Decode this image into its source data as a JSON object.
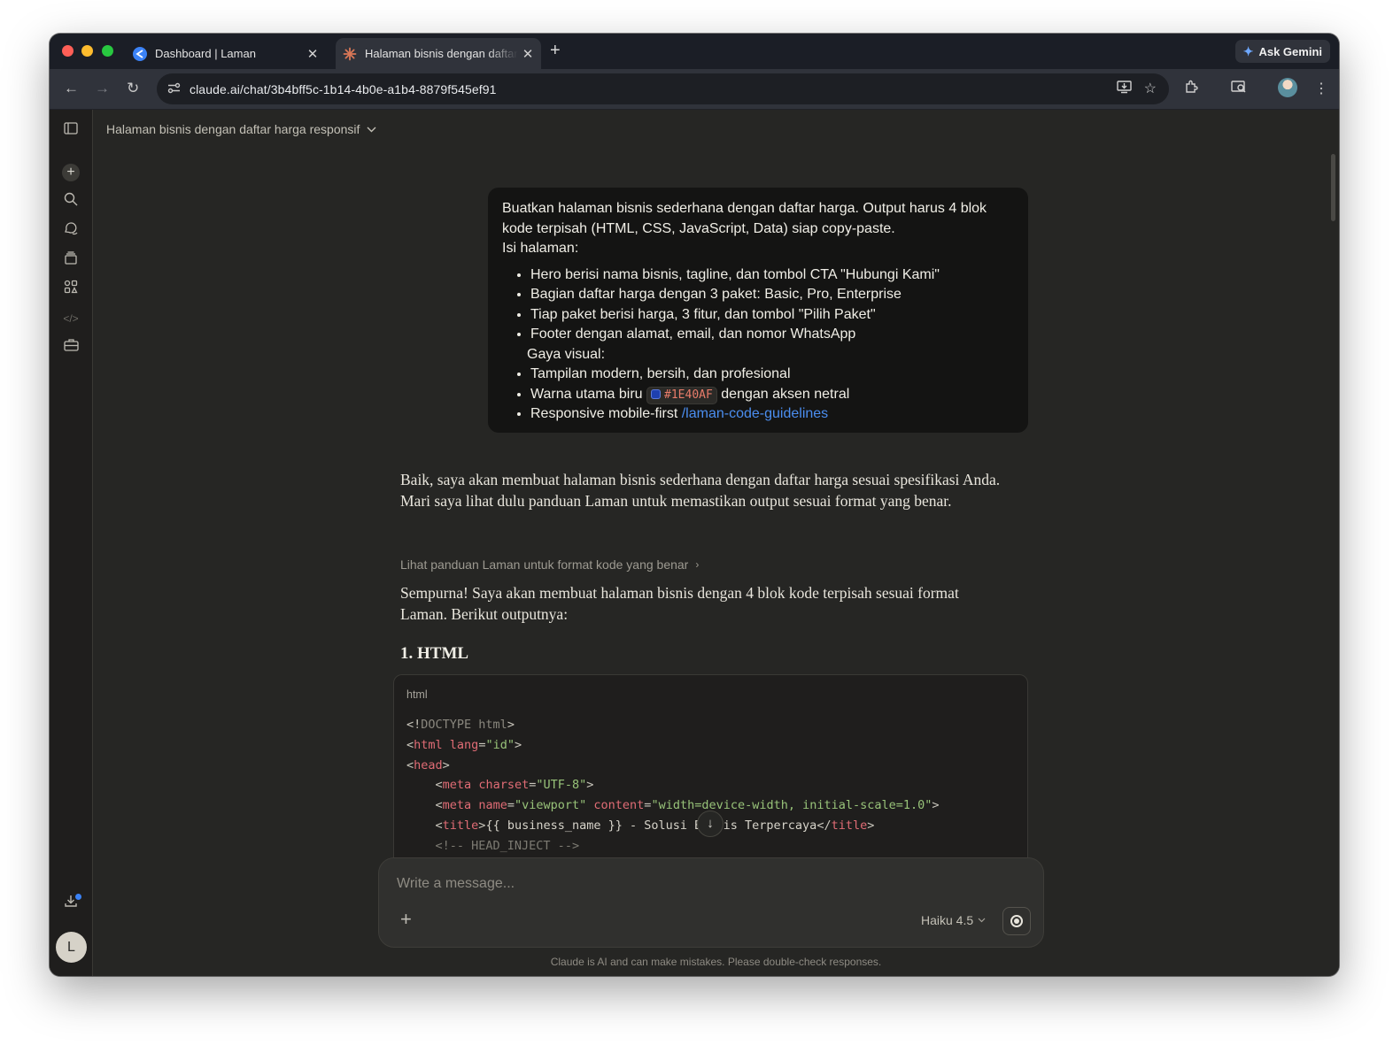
{
  "browser": {
    "tabs": [
      {
        "title": "Dashboard | Laman",
        "close": "✕"
      },
      {
        "title": "Halaman bisnis dengan daftar harga responsif",
        "close": "✕"
      }
    ],
    "new_tab": "+",
    "ask_gemini": "Ask Gemini",
    "url": "claude.ai/chat/3b4bff5c-1b14-4b0e-a1b4-8879f545ef91",
    "accent": "#3b82f6"
  },
  "sidebar": {
    "user_initial": "L",
    "icons": [
      "sidebar-toggle-icon",
      "new-chat-icon",
      "search-icon",
      "chats-icon",
      "projects-icon",
      "artifacts-icon",
      "code-icon",
      "tools-icon",
      "download-icon"
    ]
  },
  "chat": {
    "title": "Halaman bisnis dengan daftar harga responsif",
    "user_message": {
      "intro_1": "Buatkan halaman bisnis sederhana dengan daftar harga. Output harus 4 blok kode terpisah (HTML, CSS, JavaScript, Data) siap copy-paste.",
      "intro_2": "Isi halaman:",
      "bullets_1": [
        "Hero berisi nama bisnis, tagline, dan tombol CTA \"Hubungi Kami\"",
        "Bagian daftar harga dengan 3 paket: Basic, Pro, Enterprise",
        "Tiap paket berisi harga, 3 fitur, dan tombol \"Pilih Paket\"",
        "Footer dengan alamat, email, dan nomor WhatsApp"
      ],
      "gaya_label": "Gaya visual:",
      "bullet_modern": "Tampilan modern, bersih, dan profesional",
      "bullet_color_before": "Warna utama biru",
      "hex_value": "#1E40AF",
      "bullet_color_after": "dengan aksen netral",
      "bullet_responsive": "Responsive mobile-first",
      "guidelines_link": "/laman-code-guidelines"
    },
    "assistant": {
      "para_1": "Baik, saya akan membuat halaman bisnis sederhana dengan daftar harga sesuai spesifikasi Anda. Mari saya lihat dulu panduan Laman untuk memastikan output sesuai format yang benar.",
      "tool_call": "Lihat panduan Laman untuk format kode yang benar",
      "para_2": "Sempurna! Saya akan membuat halaman bisnis dengan 4 blok kode terpisah sesuai format Laman. Berikut outputnya:",
      "heading": "1. HTML",
      "code_lang": "html",
      "code_lines": [
        "<!DOCTYPE html>",
        "<html lang=\"id\">",
        "<head>",
        "    <meta charset=\"UTF-8\">",
        "    <meta name=\"viewport\" content=\"width=device-width, initial-scale=1.0\">",
        "    <title>{{ business_name }} - Solusi Bisnis Terpercaya</title>",
        "    <!-- HEAD_INJECT -->"
      ]
    },
    "composer": {
      "placeholder": "Write a message...",
      "model": "Haiku 4.5"
    },
    "disclaimer": "Claude is AI and can make mistakes. Please double-check responses."
  }
}
